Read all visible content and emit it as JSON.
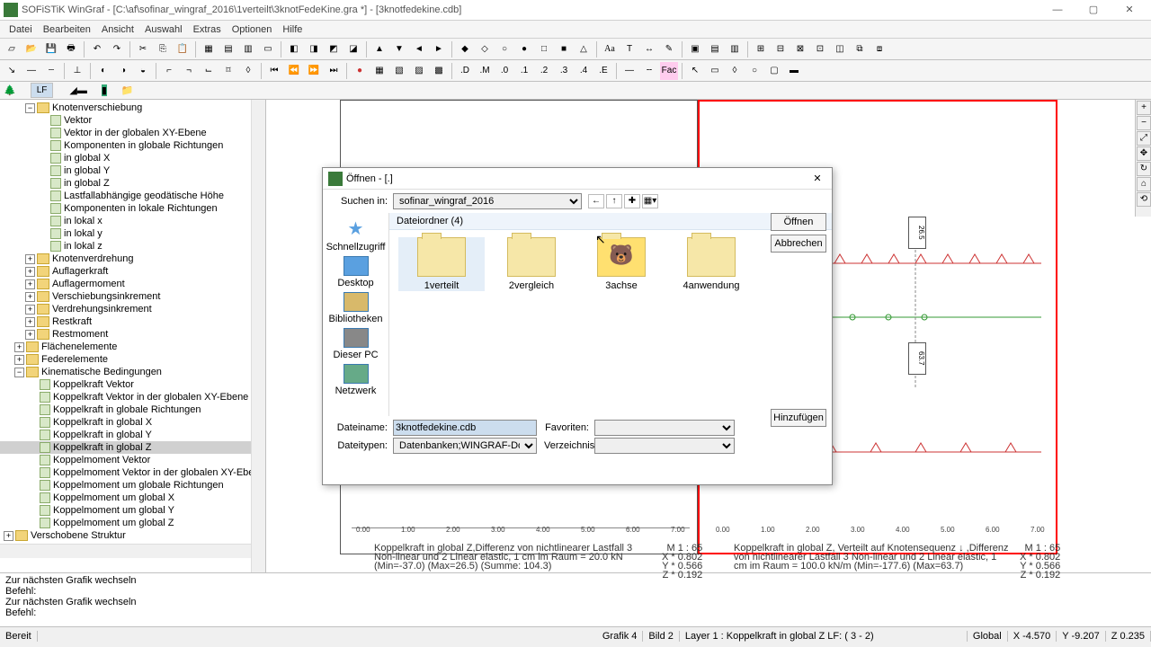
{
  "window": {
    "title": "SOFiSTiK WinGraf - [C:\\af\\sofinar_wingraf_2016\\1verteilt\\3knotFedeKine.gra *] - [3knotfedekine.cdb]",
    "btn_min": "—",
    "btn_max": "▢",
    "btn_close": "✕"
  },
  "menu": [
    "Datei",
    "Bearbeiten",
    "Ansicht",
    "Auswahl",
    "Extras",
    "Optionen",
    "Hilfe"
  ],
  "tabs": {
    "lf": "LF"
  },
  "tree": {
    "n0": "Knotenverschiebung",
    "n1": "Vektor",
    "n2": "Vektor in der globalen XY-Ebene",
    "n3": "Komponenten in globale Richtungen",
    "n4": "in global X",
    "n5": "in global Y",
    "n6": "in global Z",
    "n7": "Lastfallabhängige geodätische Höhe",
    "n8": "Komponenten in lokale Richtungen",
    "n9": "in lokal x",
    "n10": "in lokal y",
    "n11": "in lokal z",
    "n12": "Knotenverdrehung",
    "n13": "Auflagerkraft",
    "n14": "Auflagermoment",
    "n15": "Verschiebungsinkrement",
    "n16": "Verdrehungsinkrement",
    "n17": "Restkraft",
    "n18": "Restmoment",
    "n19": "Flächenelemente",
    "n20": "Federelemente",
    "n21": "Kinematische Bedingungen",
    "n22": "Koppelkraft Vektor",
    "n23": "Koppelkraft Vektor in der globalen XY-Ebene",
    "n24": "Koppelkraft in globale Richtungen",
    "n25": "Koppelkraft in global X",
    "n26": "Koppelkraft in global Y",
    "n27": "Koppelkraft in global Z",
    "n28": "Koppelmoment Vektor",
    "n29": "Koppelmoment Vektor in der globalen XY-Eber",
    "n30": "Koppelmoment um globale Richtungen",
    "n31": "Koppelmoment um global X",
    "n32": "Koppelmoment um global Y",
    "n33": "Koppelmoment um global Z",
    "n34": "Verschobene Struktur"
  },
  "dialog": {
    "title": "Öffnen - [.]",
    "search_in": "Suchen in:",
    "search_val": "sofinar_wingraf_2016",
    "group_hdr": "Dateiordner (4)",
    "places": {
      "p0": "Schnellzugriff",
      "p1": "Desktop",
      "p2": "Bibliotheken",
      "p3": "Dieser PC",
      "p4": "Netzwerk"
    },
    "folders": [
      "1verteilt",
      "2vergleich",
      "3achse",
      "4anwendung"
    ],
    "btn_open": "Öffnen",
    "btn_cancel": "Abbrechen",
    "btn_add": "Hinzufügen",
    "filename_lbl": "Dateiname:",
    "filename_val": "3knotfedekine.cdb",
    "filetype_lbl": "Dateitypen:",
    "filetype_val": "Datenbanken;WINGRAF-Dokument;WI",
    "fav_lbl": "Favoriten:",
    "dir_lbl": "Verzeichnisse:"
  },
  "log": {
    "l0": "Zur nächsten Grafik wechseln",
    "l1": "Befehl:",
    "l2": "Zur nächsten Grafik wechseln",
    "l3": "Befehl:"
  },
  "status": {
    "ready": "Bereit",
    "grafik": "Grafik    4",
    "bild": "Bild    2",
    "layer": "Layer    1 : Koppelkraft in global Z  LF: (         3 -        2)",
    "global": "Global",
    "x": "X -4.570",
    "y": "Y -9.207",
    "z": "Z 0.235"
  },
  "graph": {
    "ticks_x": [
      "0.00",
      "1.00",
      "2.00",
      "3.00",
      "4.00",
      "5.00",
      "6.00",
      "7.00"
    ],
    "cap1a": "Koppelkraft in global Z,Differenz von nichtlinearer Lastfall 3",
    "cap1b": "Non-linear und 2 Linear elastic, 1 cm im Raum = 20.0 kN",
    "cap1c": "(Min=-37.0)  (Max=26.5)  (Summe: 104.3)",
    "cap1m": "M 1 : 65",
    "cap1x": "X * 0.802",
    "cap1y": "Y * 0.566",
    "cap1z": "Z * 0.192",
    "cap2a": "Koppelkraft in global Z, Verteilt auf Knotensequenz ↓ ,Differenz",
    "cap2b": "von nichtlinearer Lastfall 3 Non-linear und 2 Linear elastic, 1",
    "cap2c": "cm im Raum = 100.0 kN/m (Min=-177.6)  (Max=63.7)",
    "node_top": "26.5",
    "node_bot": "63.7"
  }
}
